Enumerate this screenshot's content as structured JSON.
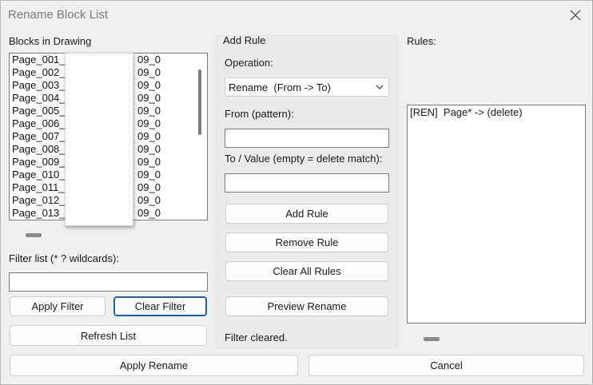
{
  "window": {
    "title": "Rename Block List"
  },
  "left": {
    "heading": "Blocks in Drawing",
    "items": [
      {
        "a": "Page_001_",
        "b": "09_0"
      },
      {
        "a": "Page_002_",
        "b": "09_0"
      },
      {
        "a": "Page_003_",
        "b": "09_0"
      },
      {
        "a": "Page_004_",
        "b": "09_0"
      },
      {
        "a": "Page_005_",
        "b": "09_0"
      },
      {
        "a": "Page_006_",
        "b": "09_0"
      },
      {
        "a": "Page_007_",
        "b": "09_0"
      },
      {
        "a": "Page_008_",
        "b": "09_0"
      },
      {
        "a": "Page_009_",
        "b": "09_0"
      },
      {
        "a": "Page_010_",
        "b": "09_0"
      },
      {
        "a": "Page_011_",
        "b": "09_0"
      },
      {
        "a": "Page_012_",
        "b": "09_0"
      },
      {
        "a": "Page_013_",
        "b": "09_0"
      }
    ],
    "filter_label": "Filter list (* ? wildcards):",
    "filter_value": "",
    "apply_filter": "Apply Filter",
    "clear_filter": "Clear Filter",
    "refresh": "Refresh List"
  },
  "middle": {
    "group_title": "Add Rule",
    "operation_label": "Operation:",
    "operation_value": "Rename  (From -> To)",
    "from_label": "From (pattern):",
    "from_value": "",
    "to_label": "To / Value (empty = delete match):",
    "to_value": "",
    "add_rule": "Add Rule",
    "remove_rule": "Remove Rule",
    "clear_rules": "Clear All Rules",
    "preview": "Preview Rename",
    "status": "Filter cleared."
  },
  "right": {
    "heading": "Rules:",
    "rules": [
      "[REN]  Page* -> (delete)"
    ]
  },
  "footer": {
    "apply_rename": "Apply Rename",
    "cancel": "Cancel"
  }
}
